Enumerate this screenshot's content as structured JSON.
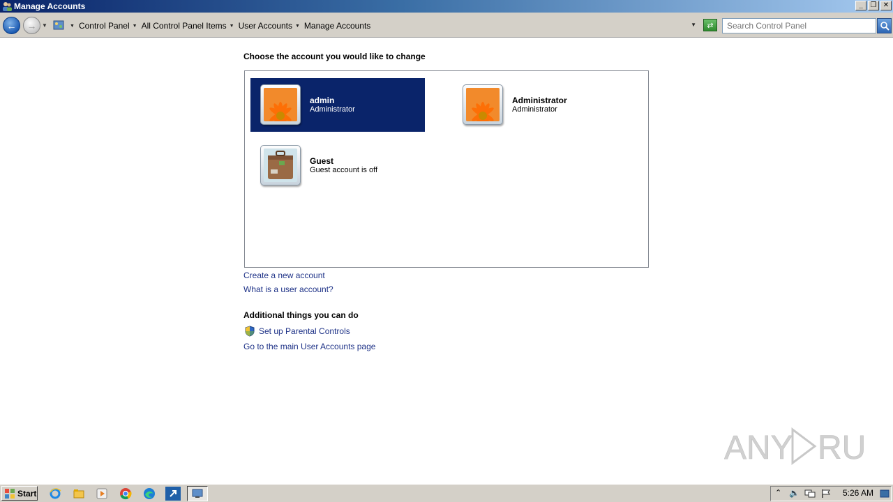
{
  "window": {
    "title": "Manage Accounts"
  },
  "address_bar": {
    "crumbs": [
      "Control Panel",
      "All Control Panel Items",
      "User Accounts",
      "Manage Accounts"
    ]
  },
  "search": {
    "placeholder": "Search Control Panel"
  },
  "main": {
    "heading": "Choose the account you would like to change",
    "accounts": [
      {
        "name": "admin",
        "type": "Administrator",
        "picture": "flower-icon",
        "selected": true
      },
      {
        "name": "Administrator",
        "type": "Administrator",
        "picture": "flower-icon",
        "selected": false
      },
      {
        "name": "Guest",
        "type": "Guest account is off",
        "picture": "suitcase-icon",
        "selected": false
      }
    ],
    "links": {
      "create_account": "Create a new account",
      "what_is": "What is a user account?"
    },
    "additional": {
      "heading": "Additional things you can do",
      "parental_controls": "Set up Parental Controls",
      "main_page": "Go to the main User Accounts page"
    }
  },
  "taskbar": {
    "start_label": "Start",
    "pinned": [
      "internet-explorer-icon",
      "file-explorer-icon",
      "media-player-icon",
      "chrome-icon",
      "edge-icon",
      "shortcut-icon",
      "control-panel-icon"
    ],
    "clock": "5:26 AM"
  },
  "watermark": "ANY RUN",
  "colors": {
    "selection": "#0a246a",
    "link": "#1e3287",
    "taskbar": "#d4d0c8"
  }
}
